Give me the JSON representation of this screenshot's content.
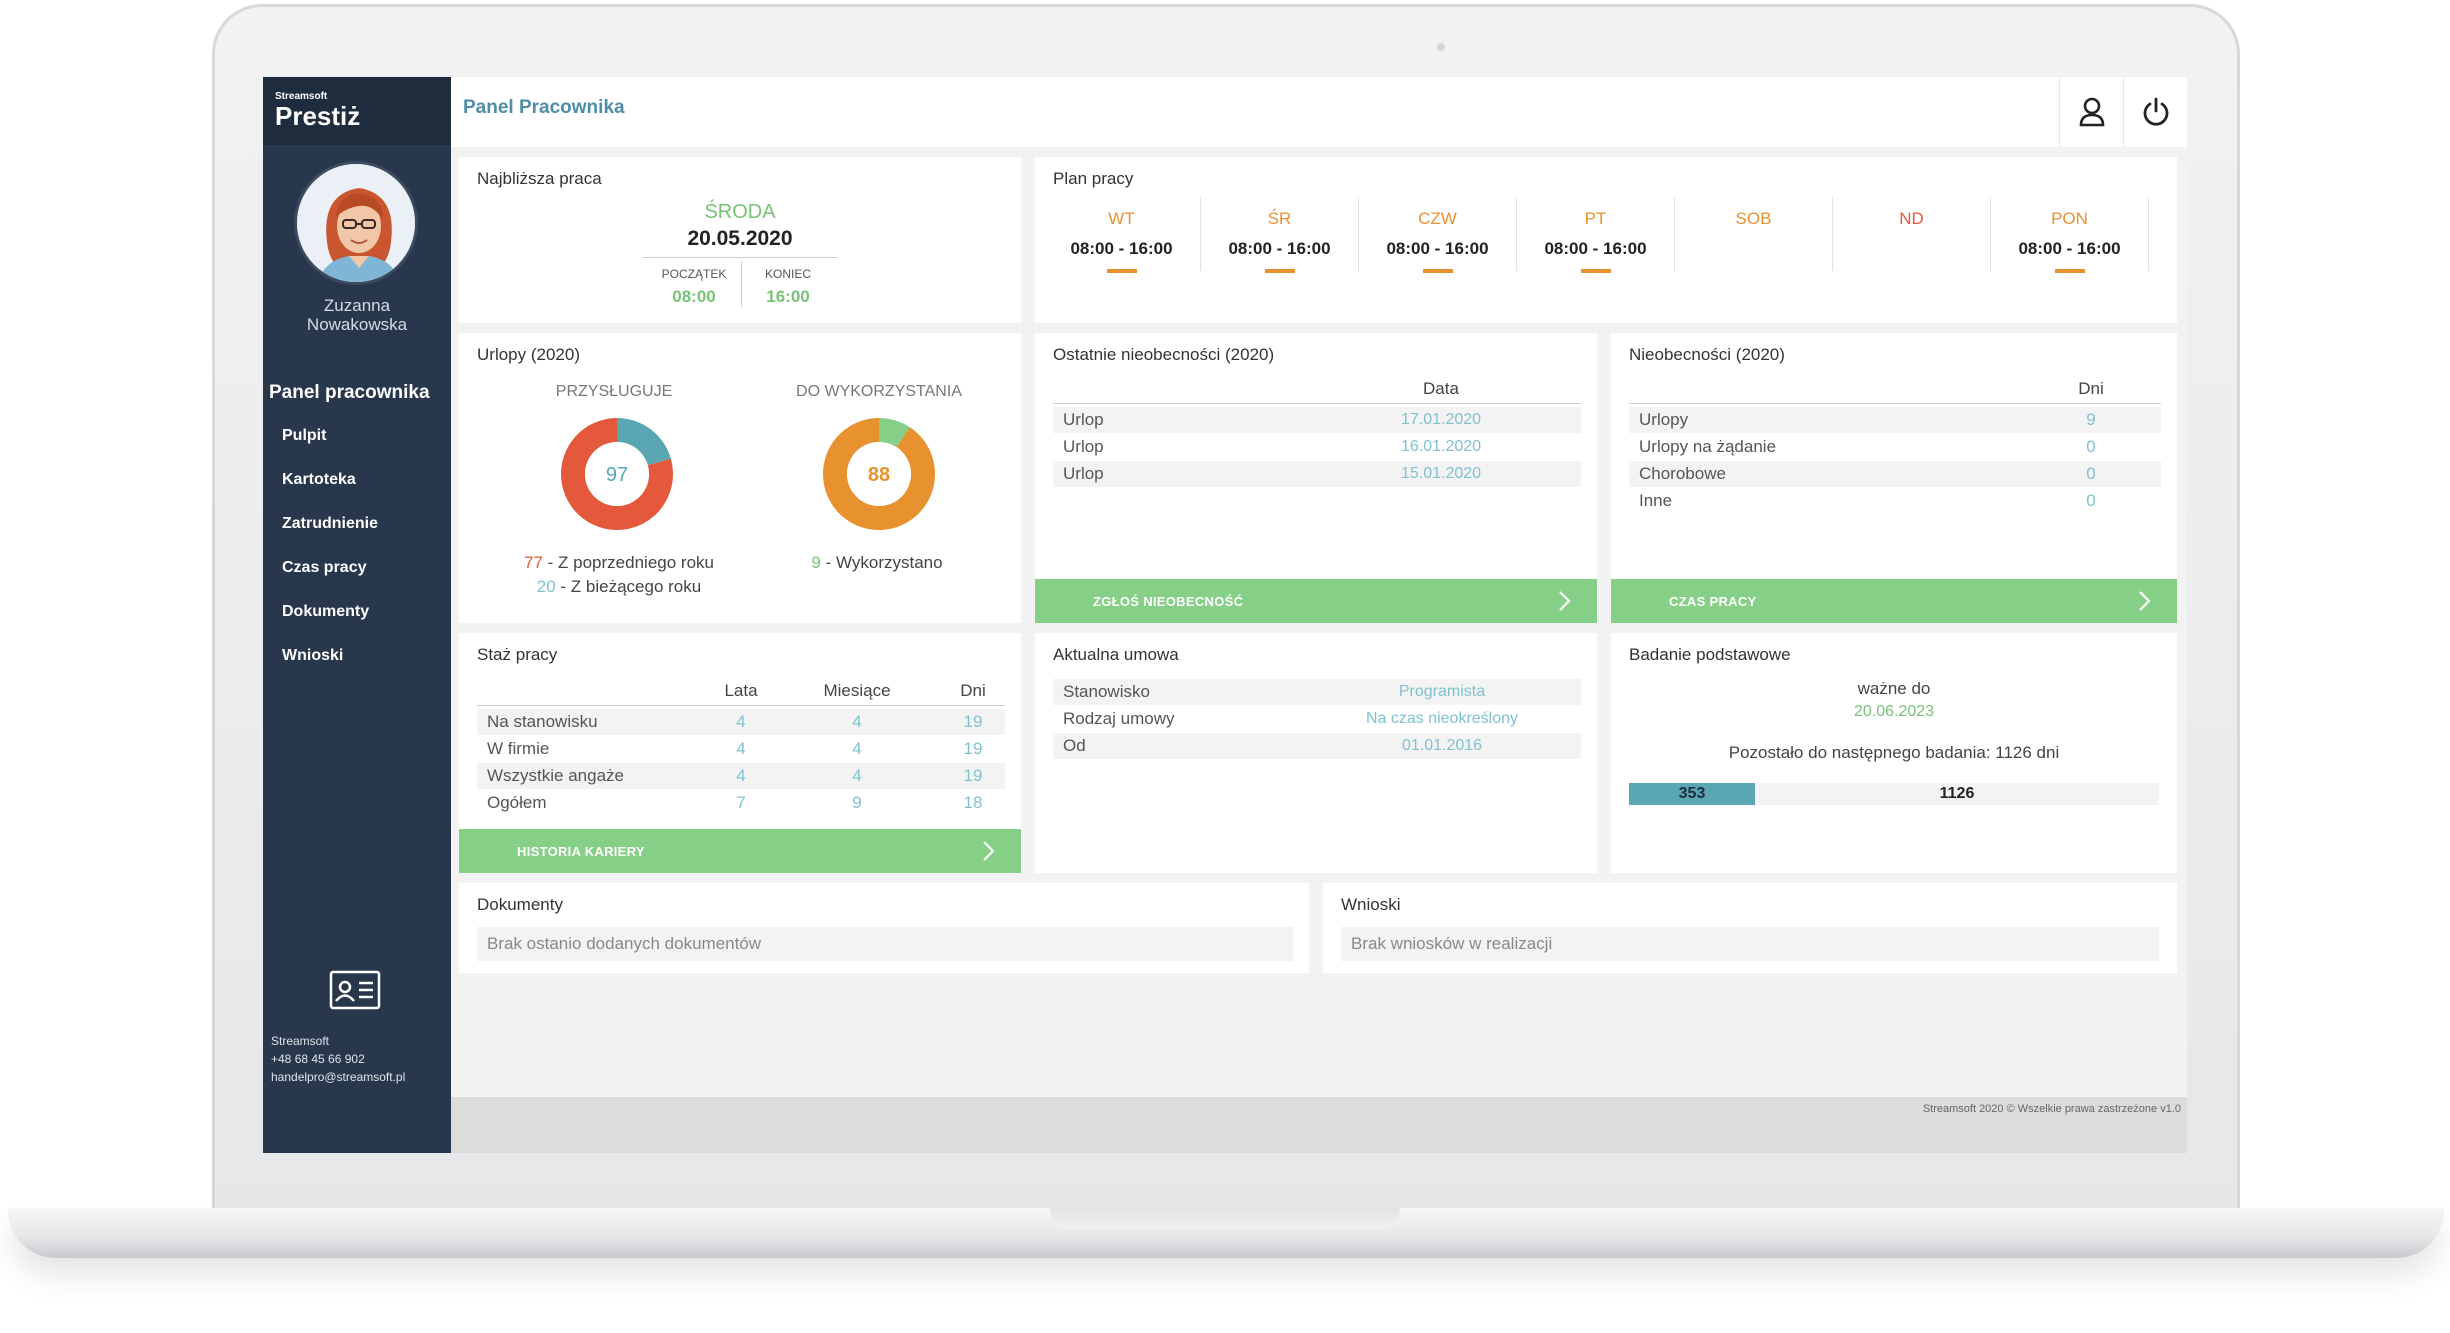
{
  "brand": {
    "small": "Streamsoft",
    "big": "Prestiż"
  },
  "user": {
    "first": "Zuzanna",
    "last": "Nowakowska"
  },
  "sidebar": {
    "title": "Panel pracownika",
    "items": [
      "Pulpit",
      "Kartoteka",
      "Zatrudnienie",
      "Czas pracy",
      "Dokumenty",
      "Wnioski"
    ],
    "contact": {
      "company": "Streamsoft",
      "phone": "+48 68 45 66 902",
      "email": "handelpro@streamsoft.pl"
    }
  },
  "topbar": {
    "title": "Panel Pracownika",
    "user_icon": "user-icon",
    "power_icon": "power-icon"
  },
  "nearest_work": {
    "title": "Najbliższa praca",
    "day": "ŚRODA",
    "date": "20.05.2020",
    "start_label": "POCZĄTEK",
    "start": "08:00",
    "end_label": "KONIEC",
    "end": "16:00"
  },
  "work_plan": {
    "title": "Plan pracy",
    "days": [
      {
        "day": "WT",
        "hours": "08:00 - 16:00",
        "color": "#e8912f"
      },
      {
        "day": "ŚR",
        "hours": "08:00 - 16:00",
        "color": "#e8912f"
      },
      {
        "day": "CZW",
        "hours": "08:00 - 16:00",
        "color": "#e8912f"
      },
      {
        "day": "PT",
        "hours": "08:00 - 16:00",
        "color": "#e8912f"
      },
      {
        "day": "SOB",
        "hours": "",
        "color": "#e8912f"
      },
      {
        "day": "ND",
        "hours": "",
        "color": "#e4593c"
      },
      {
        "day": "PON",
        "hours": "08:00 - 16:00",
        "color": "#e8912f"
      }
    ]
  },
  "vacation": {
    "title": "Urlopy (2020)",
    "entitled_label": "PRZYSŁUGUJE",
    "entitled_total": "97",
    "entitled_prev": "77",
    "entitled_prev_label": " - Z poprzedniego roku",
    "entitled_curr": "20",
    "entitled_curr_label": " - Z bieżącego roku",
    "available_label": "DO WYKORZYSTANIA",
    "available_total": "88",
    "used": "9",
    "used_label": " - Wykorzystano",
    "colors": {
      "prev": "#e4593c",
      "curr": "#5aa6b3",
      "available": "#e8912f",
      "used": "#86cf86"
    }
  },
  "recent_absences": {
    "title": "Ostatnie nieobecności (2020)",
    "col": "Data",
    "rows": [
      {
        "type": "Urlop",
        "date": "17.01.2020"
      },
      {
        "type": "Urlop",
        "date": "16.01.2020"
      },
      {
        "type": "Urlop",
        "date": "15.01.2020"
      }
    ],
    "button": "ZGŁOŚ NIEOBECNOŚĆ"
  },
  "absences": {
    "title": "Nieobecności (2020)",
    "col": "Dni",
    "rows": [
      {
        "type": "Urlopy",
        "days": "9"
      },
      {
        "type": "Urlopy na żądanie",
        "days": "0"
      },
      {
        "type": "Chorobowe",
        "days": "0"
      },
      {
        "type": "Inne",
        "days": "0"
      }
    ],
    "button": "CZAS PRACY"
  },
  "seniority": {
    "title": "Staż pracy",
    "cols": [
      "Lata",
      "Miesiące",
      "Dni"
    ],
    "rows": [
      {
        "label": "Na stanowisku",
        "y": "4",
        "m": "4",
        "d": "19"
      },
      {
        "label": "W firmie",
        "y": "4",
        "m": "4",
        "d": "19"
      },
      {
        "label": "Wszystkie angaże",
        "y": "4",
        "m": "4",
        "d": "19"
      },
      {
        "label": "Ogółem",
        "y": "7",
        "m": "9",
        "d": "18"
      }
    ],
    "button": "HISTORIA KARIERY"
  },
  "contract": {
    "title": "Aktualna umowa",
    "rows": [
      {
        "label": "Stanowisko",
        "value": "Programista"
      },
      {
        "label": "Rodzaj umowy",
        "value": "Na czas nieokreślony"
      },
      {
        "label": "Od",
        "value": "01.01.2016"
      }
    ]
  },
  "medical": {
    "title": "Badanie podstawowe",
    "valid_label": "ważne do",
    "valid_date": "20.06.2023",
    "remaining": "Pozostało do następnego badania: 1126 dni",
    "bar_elapsed": "353",
    "bar_remaining": "1126",
    "bar_color": "#5aa6b3"
  },
  "documents": {
    "title": "Dokumenty",
    "empty": "Brak ostanio dodanych dokumentów"
  },
  "requests": {
    "title": "Wnioski",
    "empty": "Brak wniosków w realizacji"
  },
  "footer": "Streamsoft 2020 © Wszelkie prawa zastrzeżone v1.0"
}
